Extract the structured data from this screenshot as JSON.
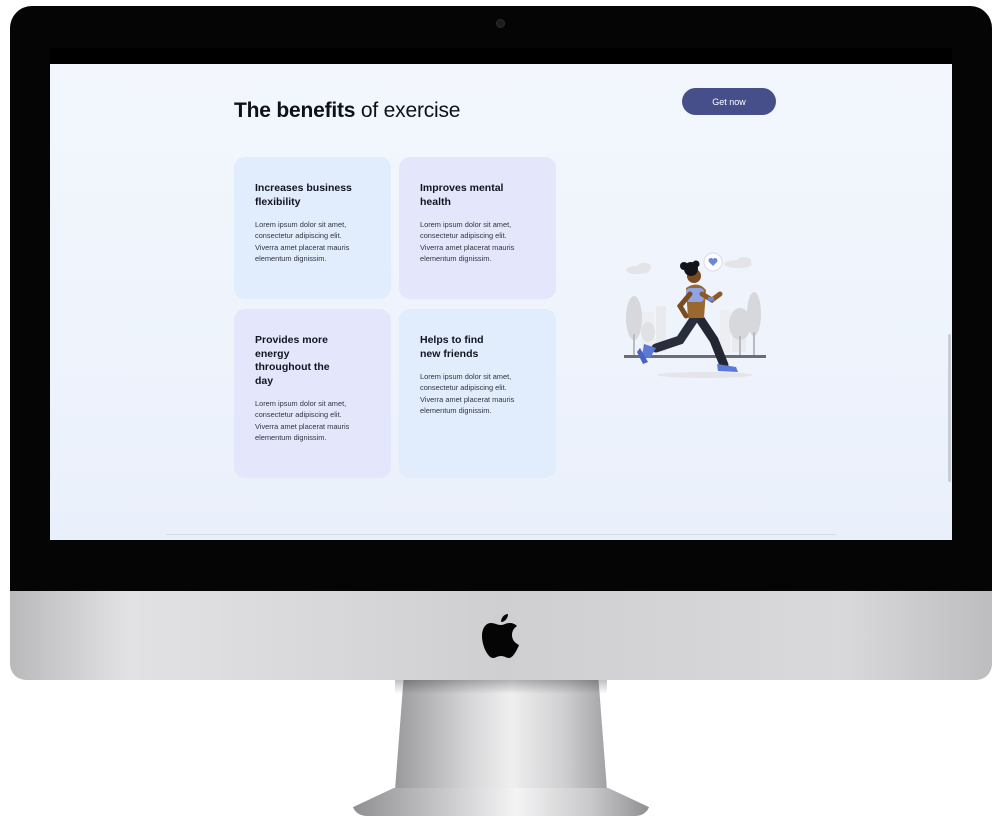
{
  "page": {
    "heading_bold": "The benefits",
    "heading_rest": " of exercise",
    "cta_label": "Get now"
  },
  "cards": [
    {
      "title": "Increases business flexibility",
      "body": "Lorem ipsum dolor sit amet, consectetur adipiscing elit. Viverra amet placerat mauris elementum dignissim."
    },
    {
      "title": "Improves mental health",
      "body": "Lorem ipsum dolor sit amet, consectetur adipiscing elit. Viverra amet placerat mauris elementum dignissim."
    },
    {
      "title": "Provides more energy throughout the day",
      "body": "Lorem ipsum dolor sit amet, consectetur adipiscing elit. Viverra amet placerat mauris elementum dignissim."
    },
    {
      "title": "Helps to find new friends",
      "body": "Lorem ipsum dolor sit amet, consectetur adipiscing elit. Viverra amet placerat mauris elementum dignissim."
    }
  ],
  "illustration": {
    "icon": "running-woman-illustration",
    "speech_icon": "heart-icon"
  },
  "colors": {
    "accent": "#474f8b",
    "card_blue": "#e1ecfc",
    "card_lavender": "#e4e7fb",
    "page_bg": "#f3f7fd"
  },
  "device": {
    "logo": "apple-logo-icon"
  }
}
